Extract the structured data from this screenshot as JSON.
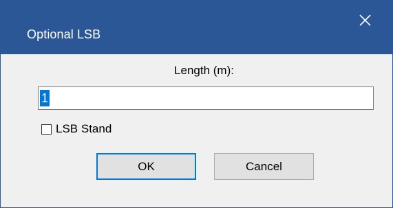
{
  "window": {
    "title": "Optional LSB",
    "close_icon": "close-icon"
  },
  "form": {
    "length_label": "Length (m):",
    "length_value": "1",
    "lsb_stand_label": "LSB Stand",
    "lsb_stand_checked": false
  },
  "buttons": {
    "ok_label": "OK",
    "cancel_label": "Cancel"
  },
  "colors": {
    "titlebar": "#2b5797",
    "dialog_background": "#f0f0f0",
    "selection": "#0078d7",
    "default_button_border": "#0078d7"
  }
}
